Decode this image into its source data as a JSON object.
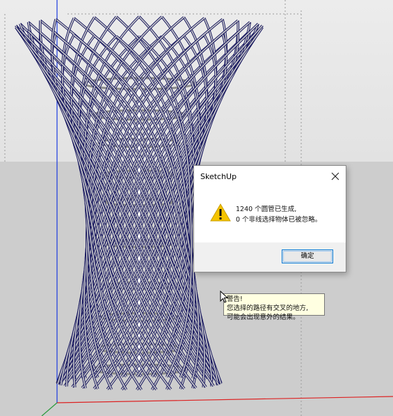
{
  "app": "SketchUp",
  "dialog": {
    "title": "SketchUp",
    "line1": "1240 个圆管已生成,",
    "line2": "0 个非线选择物体已被忽略。",
    "ok_label": "确定"
  },
  "tooltip": {
    "line1": "警告!",
    "line2": "您选择的路径有交叉的地方,",
    "line3": "可能会出现意外的结果。"
  },
  "colors": {
    "sky": "#e6e6e6",
    "ground": "#cfcfcf",
    "tube_outline": "#1a1a60",
    "tube_fill": "#c8c8c8",
    "axis_blue": "#1a3ae0",
    "axis_red": "#d22",
    "axis_green": "#2a9a3a",
    "warning_yellow": "#f5c400"
  },
  "icons": [
    "warning-icon",
    "close-icon",
    "cursor-icon"
  ]
}
